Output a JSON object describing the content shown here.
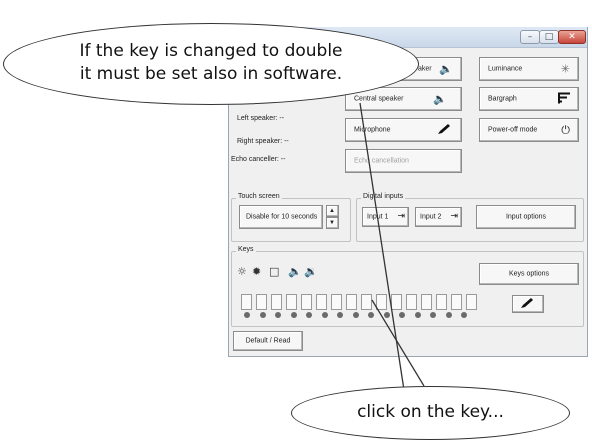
{
  "window": {
    "buttons": {
      "minimize": "–",
      "maximize": "□",
      "close": "✕"
    }
  },
  "speakers_panel": {
    "left_speaker": "Left speaker:  --",
    "right_speaker": "Right speaker:  --",
    "echo_canceller": "Echo canceller:  --"
  },
  "audio_buttons": {
    "speaker": {
      "label": "aker",
      "icon": "speaker-icon"
    },
    "central_speaker": {
      "label": "Central speaker",
      "icon": "speaker-icon"
    },
    "microphone": {
      "label": "Microphone",
      "icon": "microphone-icon"
    },
    "echo_cancellation": {
      "label": "Echo cancellation"
    }
  },
  "display_buttons": {
    "luminance": {
      "label": "Luminance",
      "icon": "sun-icon"
    },
    "bargraph": {
      "label": "Bargraph",
      "icon": "bargraph-icon"
    },
    "power_off_mode": {
      "label": "Power-off mode",
      "icon": "power-icon"
    }
  },
  "touch_screen": {
    "title": "Touch screen",
    "disable_label": "Disable for 10 seconds"
  },
  "digital_inputs": {
    "title": "Digital inputs",
    "input1": "Input 1",
    "input2": "Input 2",
    "options": "Input options"
  },
  "keys": {
    "title": "Keys",
    "options": "Keys options",
    "icons": [
      "sun-outline-icon",
      "sun-filled-icon",
      "square-icon",
      "speaker-low-icon",
      "speaker-icon"
    ],
    "microphone_icon": "microphone-icon",
    "slot_count": 16,
    "led_count": 15
  },
  "footer": {
    "default_read": "Default / Read"
  },
  "callouts": {
    "top_line1": "If the key is changed to double",
    "top_line2": "it must be set also in software.",
    "bottom": "click on the key..."
  }
}
